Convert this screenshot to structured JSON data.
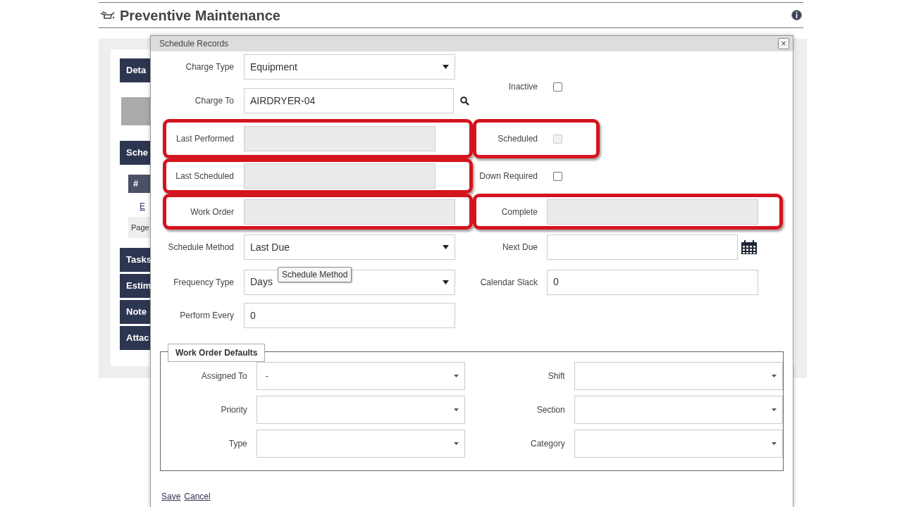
{
  "page": {
    "title": "Preventive Maintenance"
  },
  "background_sections": [
    {
      "label": "Deta",
      "kind": "header"
    },
    {
      "kind": "block"
    },
    {
      "label": "Sche",
      "kind": "header"
    },
    {
      "label": "#",
      "kind": "table-head"
    },
    {
      "label": "E",
      "kind": "link"
    },
    {
      "label": "Page",
      "kind": "pager"
    },
    {
      "label": "Tasks",
      "kind": "header"
    },
    {
      "label": "Estim",
      "kind": "header"
    },
    {
      "label": "Note",
      "kind": "header"
    },
    {
      "label": "Attac",
      "kind": "header"
    }
  ],
  "dialog": {
    "title": "Schedule Records",
    "close": "×",
    "rows": [
      {
        "left": {
          "label": "Charge Type",
          "kind": "select",
          "value": "Equipment",
          "highlighted": false
        }
      },
      {
        "left": {
          "label": "Charge To",
          "kind": "lookup",
          "value": "AIRDRYER-04",
          "highlighted": false
        },
        "right": {
          "label": "Inactive",
          "kind": "checkbox",
          "checked": false,
          "disabled": false,
          "highlighted": false
        }
      },
      {
        "left": {
          "label": "Last Performed",
          "kind": "readonly",
          "highlighted": true
        },
        "right": {
          "label": "Scheduled",
          "kind": "checkbox",
          "checked": false,
          "disabled": true,
          "highlighted": true
        }
      },
      {
        "left": {
          "label": "Last Scheduled",
          "kind": "readonly",
          "highlighted": true
        },
        "right": {
          "label": "Down Required",
          "kind": "checkbox",
          "checked": false,
          "disabled": false,
          "highlighted": false
        }
      },
      {
        "left": {
          "label": "Work Order",
          "kind": "readonly",
          "highlighted": true
        },
        "right": {
          "label": "Complete",
          "kind": "readonly",
          "highlighted": true
        }
      },
      {
        "left": {
          "label": "Schedule Method",
          "kind": "select",
          "value": "Last Due",
          "highlighted": false
        },
        "right": {
          "label": "Next Due",
          "kind": "date",
          "highlighted": false
        }
      },
      {
        "left": {
          "label": "Frequency Type",
          "kind": "select",
          "value": "Days",
          "tooltip": "Schedule Method",
          "highlighted": false
        },
        "right": {
          "label": "Calendar Slack",
          "kind": "text",
          "value": "0",
          "highlighted": false
        }
      },
      {
        "left": {
          "label": "Perform Every",
          "kind": "text",
          "value": "0",
          "highlighted": false
        }
      }
    ],
    "defaults": {
      "title": "Work Order Defaults",
      "rows": [
        {
          "left": {
            "label": "Assigned To",
            "value": "-"
          },
          "right": {
            "label": "Shift"
          }
        },
        {
          "left": {
            "label": "Priority"
          },
          "right": {
            "label": "Section"
          }
        },
        {
          "left": {
            "label": "Type"
          },
          "right": {
            "label": "Category"
          }
        }
      ]
    },
    "actions": [
      "Save",
      "Cancel"
    ]
  }
}
